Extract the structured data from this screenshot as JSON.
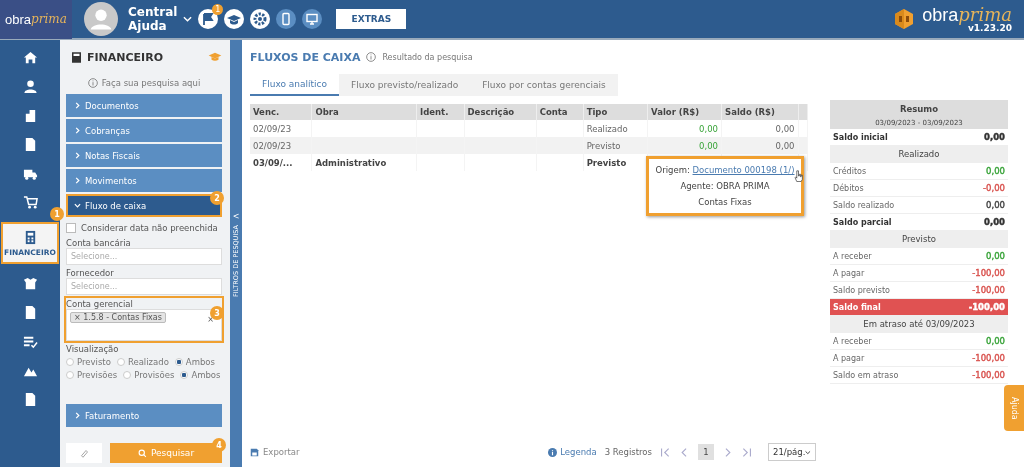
{
  "header": {
    "logo": {
      "plain": "obra",
      "script": "prima"
    },
    "user_lines": [
      "Central",
      "Ajuda"
    ],
    "notification_count": "1",
    "extras_button": "EXTRAS",
    "brand": {
      "plain": "obra",
      "script": "prima",
      "version": "v1.23.20"
    }
  },
  "nav_rail": [
    {
      "selected": false
    },
    {
      "selected": false
    },
    {
      "selected": false
    },
    {
      "selected": false
    },
    {
      "selected": false
    },
    {
      "selected": false
    },
    {
      "selected": true,
      "label": "FINANCEIRO"
    },
    {
      "selected": false
    },
    {
      "selected": false
    },
    {
      "selected": false
    },
    {
      "selected": false
    },
    {
      "selected": false
    }
  ],
  "filter_panel": {
    "title": "FINANCEIRO",
    "hint": "Faça sua pesquisa aqui",
    "sections": [
      {
        "label": "Documentos",
        "expanded": false
      },
      {
        "label": "Cobranças",
        "expanded": false
      },
      {
        "label": "Notas Fiscais",
        "expanded": false
      },
      {
        "label": "Movimentos",
        "expanded": false
      },
      {
        "label": "Fluxo de caixa",
        "expanded": true
      }
    ],
    "checkbox": {
      "label": "Considerar data não preenchida",
      "checked": false
    },
    "fields": [
      {
        "label": "Conta bancária",
        "placeholder": "Selecione..."
      },
      {
        "label": "Fornecedor",
        "placeholder": "Selecione..."
      }
    ],
    "tag_field": {
      "label": "Conta gerencial",
      "tags": [
        "1.5.8 - Contas Fixas"
      ],
      "tag_remove": "×",
      "clear": "×"
    },
    "view_label": "Visualização",
    "radio_groups": [
      [
        {
          "label": "Previsto",
          "selected": false
        },
        {
          "label": "Realizado",
          "selected": false
        },
        {
          "label": "Ambos",
          "selected": true
        }
      ],
      [
        {
          "label": "Previsões",
          "selected": false
        },
        {
          "label": "Provisões",
          "selected": false
        },
        {
          "label": "Ambos",
          "selected": true
        }
      ]
    ],
    "bottom_section": {
      "label": "Faturamento",
      "expanded": false
    },
    "search_button": "Pesquisar"
  },
  "collapse_strip": {
    "label": "FILTROS DE PESQUISA",
    "chevron": "<"
  },
  "annotations": [
    "1",
    "2",
    "3",
    "4"
  ],
  "main": {
    "title": "FLUXOS DE CAIXA",
    "info": "Resultado da pesquisa",
    "tabs": [
      {
        "label": "Fluxo analítico",
        "selected": true
      },
      {
        "label": "Fluxo previsto/realizado",
        "selected": false
      },
      {
        "label": "Fluxo por contas gerenciais",
        "selected": false
      }
    ],
    "table": {
      "columns": [
        "Venc.",
        "Obra",
        "Ident.",
        "Descrição",
        "Conta",
        "Tipo",
        "Valor (R$)",
        "Saldo (R$)"
      ],
      "rows": [
        {
          "bold": false,
          "cells": [
            "02/09/23",
            "",
            "",
            "",
            "",
            "Realizado",
            "0,00",
            "0,00"
          ]
        },
        {
          "bold": false,
          "cells": [
            "02/09/23",
            "",
            "",
            "",
            "",
            "Previsto",
            "0,00",
            "0,00"
          ]
        },
        {
          "bold": true,
          "cells": [
            "03/09/...",
            "Administrativo",
            "",
            "",
            "",
            "Previsto",
            "",
            ""
          ]
        }
      ]
    },
    "tooltip": {
      "origin_label": "Origem:",
      "origin_link": "Documento 000198 (1/)",
      "agent": "Agente: OBRA PRIMA",
      "account": "Contas Fixas"
    },
    "footer": {
      "export": "Exportar",
      "legend": "Legenda",
      "records": "3 Registros",
      "page": "1",
      "per_page": "21/pág."
    }
  },
  "summary": {
    "title": "Resumo",
    "range": "03/09/2023 - 03/09/2023",
    "rows": [
      {
        "kind": "bold",
        "label": "Saldo inicial",
        "value": "0,00",
        "color": "#333333"
      },
      {
        "kind": "section",
        "label": "Realizado"
      },
      {
        "kind": "plain",
        "label": "Créditos",
        "value": "0,00",
        "color": "#3aa43a"
      },
      {
        "kind": "plain",
        "label": "Débitos",
        "value": "-0,00",
        "color": "#d9534f"
      },
      {
        "kind": "plain",
        "label": "Saldo realizado",
        "value": "0,00",
        "color": "#444444"
      },
      {
        "kind": "bold",
        "label": "Saldo parcial",
        "value": "0,00",
        "color": "#333333"
      },
      {
        "kind": "section",
        "label": "Previsto"
      },
      {
        "kind": "plain",
        "label": "A receber",
        "value": "0,00",
        "color": "#3aa43a"
      },
      {
        "kind": "plain",
        "label": "A pagar",
        "value": "-100,00",
        "color": "#d9534f"
      },
      {
        "kind": "plain",
        "label": "Saldo previsto",
        "value": "-100,00",
        "color": "#d9534f"
      },
      {
        "kind": "alert",
        "label": "Saldo final",
        "value": "-100,00",
        "color": "#ffffff"
      },
      {
        "kind": "section",
        "label": "Em atraso até 03/09/2023"
      },
      {
        "kind": "plain",
        "label": "A receber",
        "value": "0,00",
        "color": "#3aa43a"
      },
      {
        "kind": "plain",
        "label": "A pagar",
        "value": "-100,00",
        "color": "#d9534f"
      },
      {
        "kind": "plain",
        "label": "Saldo em atraso",
        "value": "-100,00",
        "color": "#d9534f"
      }
    ]
  },
  "help_tab": "Ajuda"
}
